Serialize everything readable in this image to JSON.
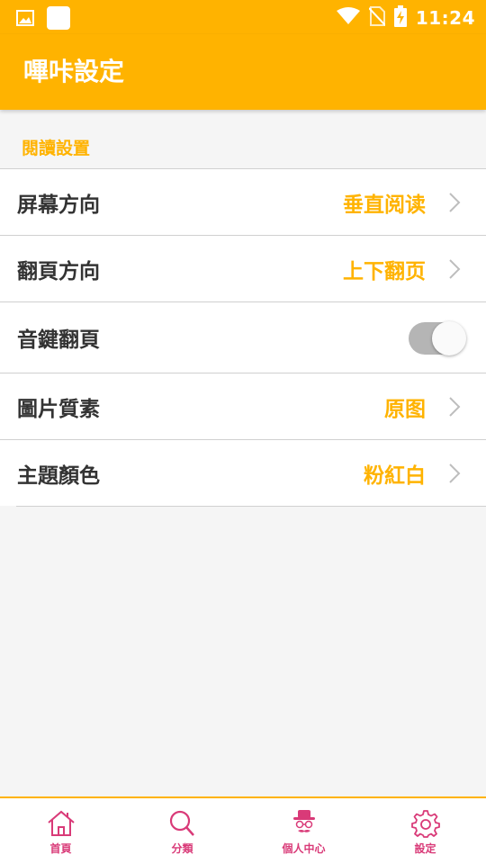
{
  "status_bar": {
    "time": "11:24",
    "icons": [
      "image-icon",
      "app-icon",
      "wifi-icon",
      "no-sim-icon",
      "battery-charging-icon"
    ]
  },
  "app_bar": {
    "title": "嗶咔設定"
  },
  "section": {
    "header": "閱讀設置"
  },
  "settings": [
    {
      "label": "屏幕方向",
      "value": "垂直阅读",
      "control": "chevron"
    },
    {
      "label": "翻頁方向",
      "value": "上下翻页",
      "control": "chevron"
    },
    {
      "label": "音鍵翻頁",
      "value": "",
      "control": "toggle",
      "enabled": true
    },
    {
      "label": "圖片質素",
      "value": "原图",
      "control": "chevron"
    },
    {
      "label": "主題顏色",
      "value": "粉紅白",
      "control": "chevron"
    }
  ],
  "tabs": [
    {
      "label": "首頁",
      "icon": "home-icon"
    },
    {
      "label": "分類",
      "icon": "search-icon"
    },
    {
      "label": "個人中心",
      "icon": "profile-hat-icon"
    },
    {
      "label": "設定",
      "icon": "gear-icon"
    }
  ],
  "colors": {
    "accent": "#ffb300",
    "tab_pink": "#d93a78",
    "label_text": "#333333",
    "toggle_track": "#b5b5b5"
  }
}
